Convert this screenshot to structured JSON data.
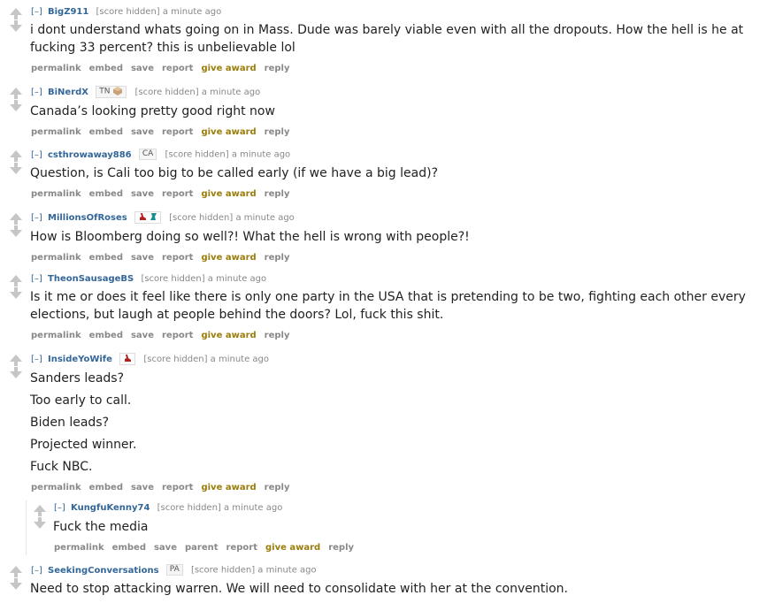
{
  "meta": {
    "score": "[score hidden]",
    "time": "a minute ago",
    "toggle": "[–]"
  },
  "buttons": {
    "permalink": "permalink",
    "embed": "embed",
    "save": "save",
    "parent": "parent",
    "report": "report",
    "give_award": "give award",
    "reply": "reply"
  },
  "comments": [
    {
      "author": "BigZ911",
      "lines": [
        "i dont understand whats going on in Mass. Dude was barely viable even with all the dropouts. How the hell is he at",
        "fucking 33 percent? this is unbelievable lol"
      ]
    },
    {
      "author": "BiNerdX",
      "flair": "TN",
      "lines": [
        "Canada’s looking pretty good right now"
      ]
    },
    {
      "author": "csthrowaway886",
      "flair": "CA",
      "lines": [
        "Question, is Cali too big to be called early (if we have a big lead)?"
      ]
    },
    {
      "author": "MillionsOfRoses",
      "lines": [
        "How is Bloomberg doing so well?! What the hell is wrong with people?!"
      ]
    },
    {
      "author": "TheonSausageBS",
      "lines": [
        "Is it me or does it feel like there is only one party in the USA that is pretending to be two, fighting each other every",
        "elections, but laugh at people behind the doors? Lol, fuck this shit."
      ]
    },
    {
      "author": "InsideYoWife",
      "lines": [
        "Sanders leads?",
        "Too early to call.",
        "Biden leads?",
        "Projected winner.",
        "Fuck NBC."
      ]
    },
    {
      "author": "KungfuKenny74",
      "lines": [
        "Fuck the media"
      ]
    },
    {
      "author": "SeekingConversations",
      "flair": "PA",
      "lines": [
        "Need to stop attacking warren. We will need to consolidate with her at the convention."
      ]
    }
  ],
  "icons": {
    "bernie": "bernie-icon",
    "warren": "warren-icon",
    "mask": "mask-icon"
  },
  "colors": {
    "author": "#336699",
    "award": "#9a7d0a",
    "arrow": "#c6c6c6",
    "meta": "#888888",
    "text": "#222222"
  }
}
